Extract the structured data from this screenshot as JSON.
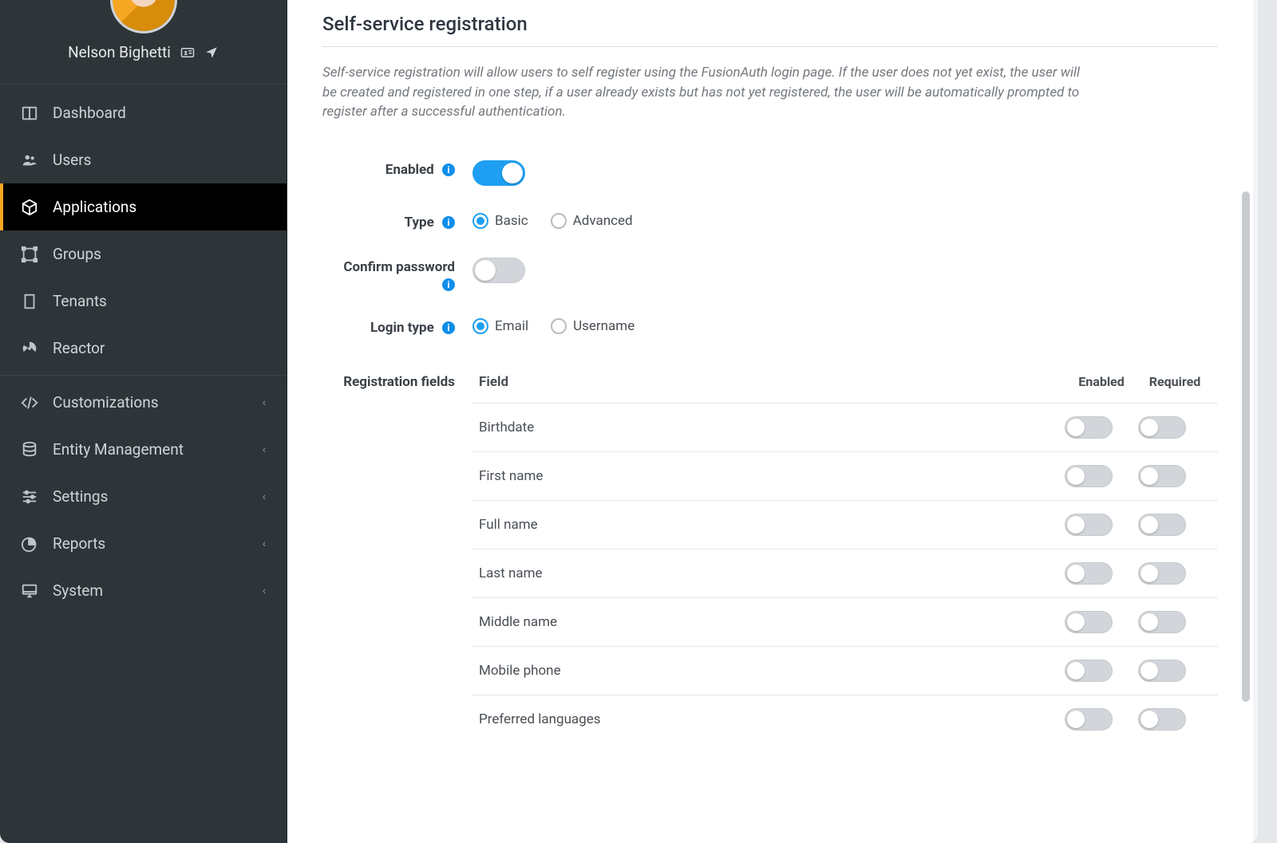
{
  "user": {
    "name": "Nelson Bighetti"
  },
  "sidebar": {
    "items": [
      {
        "label": "Dashboard"
      },
      {
        "label": "Users"
      },
      {
        "label": "Applications"
      },
      {
        "label": "Groups"
      },
      {
        "label": "Tenants"
      },
      {
        "label": "Reactor"
      },
      {
        "label": "Customizations"
      },
      {
        "label": "Entity Management"
      },
      {
        "label": "Settings"
      },
      {
        "label": "Reports"
      },
      {
        "label": "System"
      }
    ]
  },
  "section": {
    "title": "Self-service registration",
    "description": "Self-service registration will allow users to self register using the FusionAuth login page. If the user does not yet exist, the user will be created and registered in one step, if a user already exists but has not yet registered, the user will be automatically prompted to register after a successful authentication."
  },
  "form": {
    "enabled_label": "Enabled",
    "enabled": true,
    "type_label": "Type",
    "type_options": {
      "basic": "Basic",
      "advanced": "Advanced"
    },
    "type_value": "basic",
    "confirm_password_label": "Confirm password",
    "confirm_password": false,
    "login_type_label": "Login type",
    "login_type_options": {
      "email": "Email",
      "username": "Username"
    },
    "login_type_value": "email",
    "registration_fields_label": "Registration fields",
    "fields_header": {
      "field": "Field",
      "enabled": "Enabled",
      "required": "Required"
    },
    "fields": [
      {
        "name": "Birthdate",
        "enabled": false,
        "required": false
      },
      {
        "name": "First name",
        "enabled": false,
        "required": false
      },
      {
        "name": "Full name",
        "enabled": false,
        "required": false
      },
      {
        "name": "Last name",
        "enabled": false,
        "required": false
      },
      {
        "name": "Middle name",
        "enabled": false,
        "required": false
      },
      {
        "name": "Mobile phone",
        "enabled": false,
        "required": false
      },
      {
        "name": "Preferred languages",
        "enabled": false,
        "required": false
      }
    ]
  }
}
